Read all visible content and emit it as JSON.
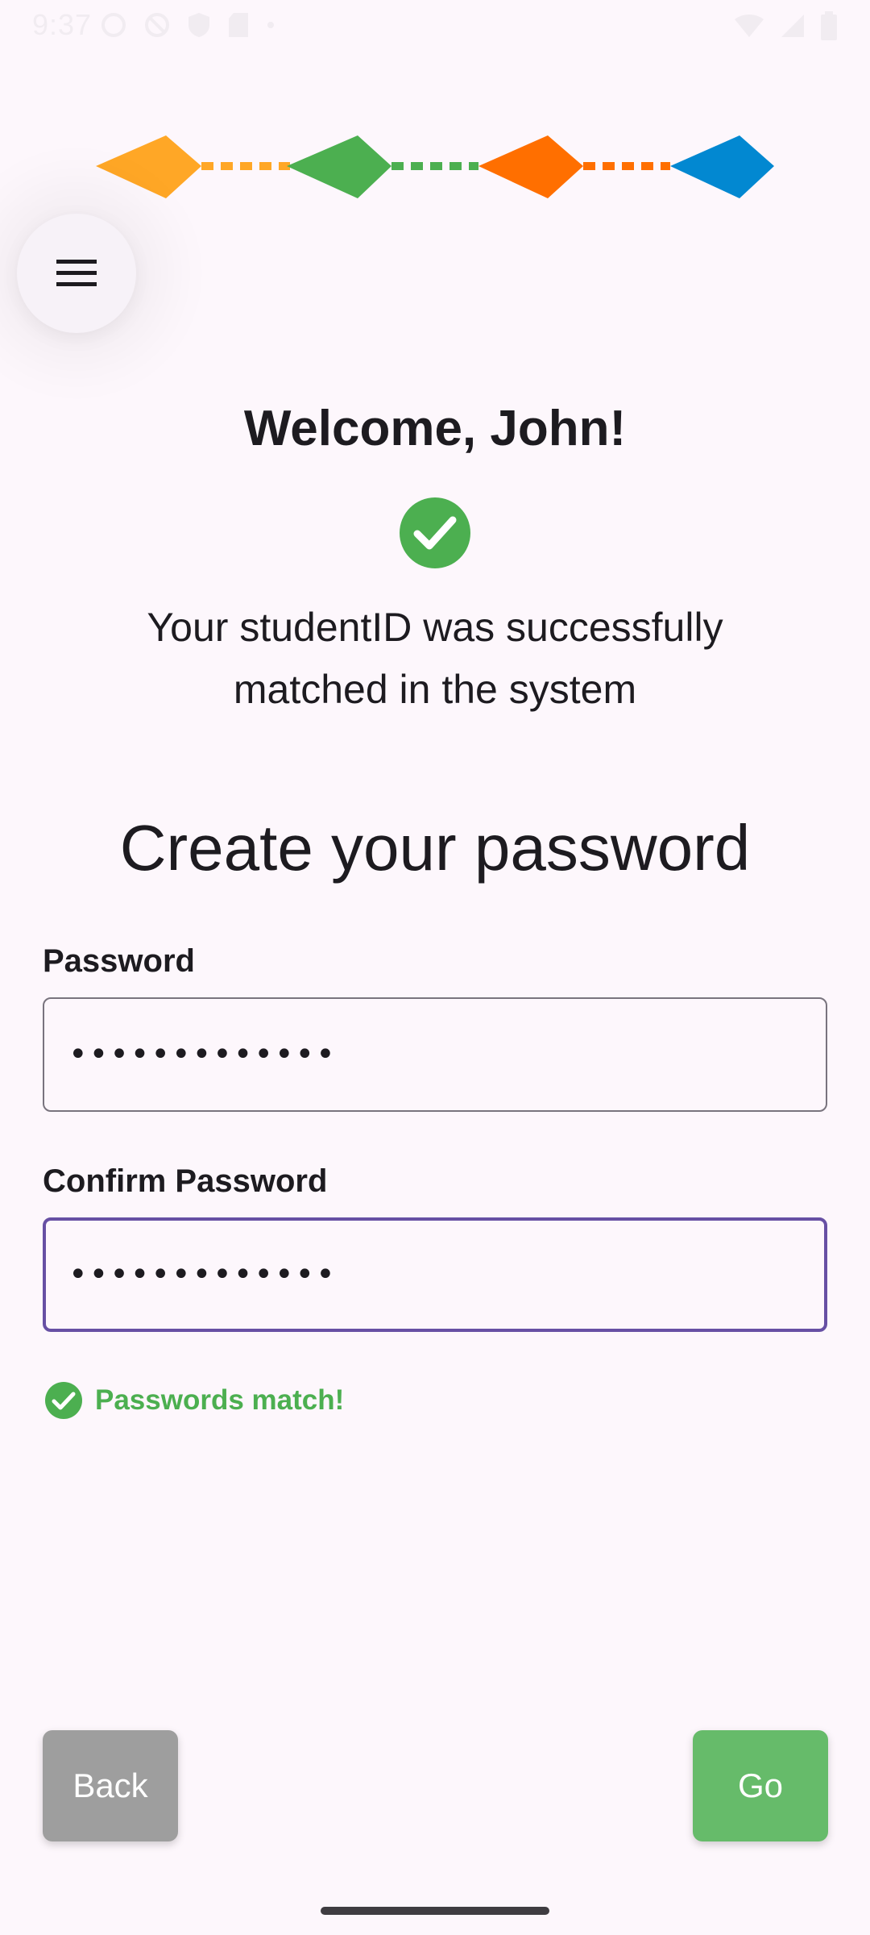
{
  "status_bar": {
    "time": "9:37",
    "left_icons": [
      "circle-status-icon",
      "no-sync-icon",
      "shield-icon",
      "sd-card-icon",
      "dot-icon"
    ],
    "right_icons": [
      "wifi-icon",
      "signal-icon",
      "battery-icon"
    ]
  },
  "stepper": {
    "steps": [
      {
        "color": "#ffa726"
      },
      {
        "color": "#4caf50"
      },
      {
        "color": "#ff6f00"
      },
      {
        "color": "#0288d1"
      }
    ]
  },
  "menu": {
    "icon": "hamburger-menu-icon"
  },
  "welcome": {
    "title": "Welcome, John!",
    "message_line1": "Your studentID was successfully",
    "message_line2": "matched in the system"
  },
  "form": {
    "heading": "Create your password",
    "password_label": "Password",
    "password_value": "•••••••••••••",
    "confirm_label": "Confirm Password",
    "confirm_value": "•••••••••••••",
    "match_message": "Passwords match!"
  },
  "buttons": {
    "back_label": "Back",
    "go_label": "Go"
  },
  "colors": {
    "background": "#fdf7fc",
    "success": "#4caf50",
    "focus": "#6750a4",
    "back_button": "#9e9e9e",
    "go_button": "#66bb6a"
  }
}
